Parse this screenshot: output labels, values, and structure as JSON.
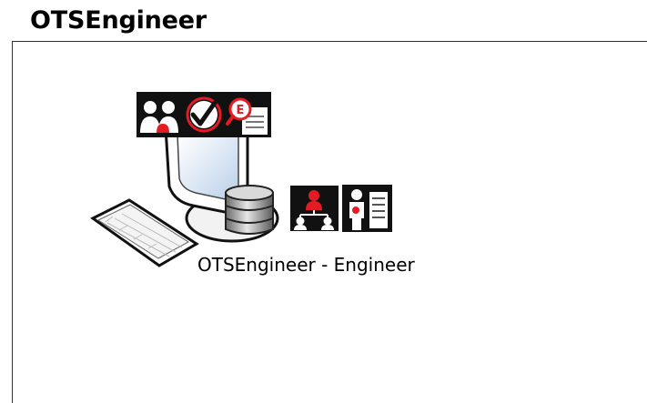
{
  "header": {
    "title": "OTSEngineer"
  },
  "node": {
    "label": "OTSEngineer - Engineer",
    "icons": [
      "workstation-icon",
      "users-icon",
      "checkmark-icon",
      "document-search-icon",
      "database-icon",
      "org-chart-icon",
      "person-server-icon",
      "keyboard-icon"
    ],
    "accent_color": "#e31c23"
  }
}
